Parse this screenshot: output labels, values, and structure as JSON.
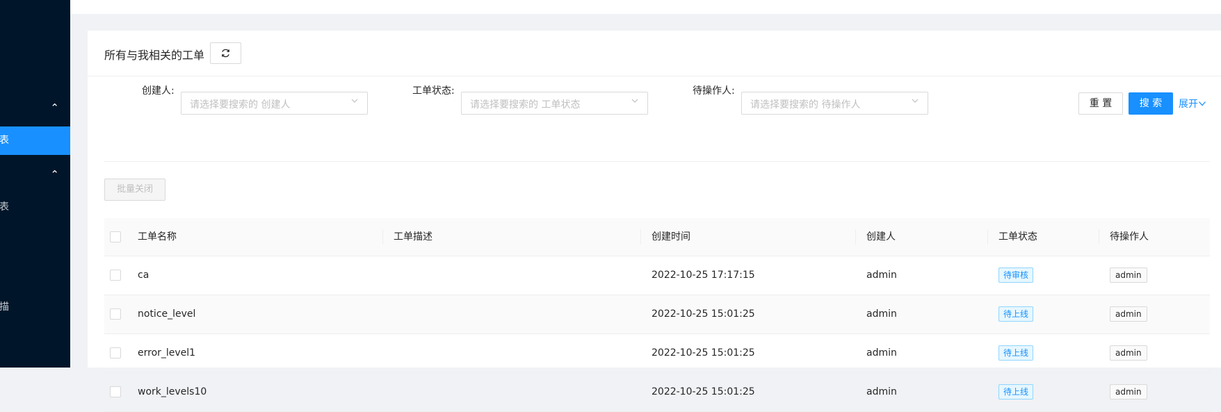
{
  "sidebar": {
    "groups": [
      {
        "chevron": "chevron-up-icon"
      },
      {
        "chevron": "chevron-up-icon"
      }
    ],
    "items": [
      {
        "label": "表",
        "active": true
      },
      {
        "label": "表",
        "active": false
      },
      {
        "label": "描",
        "active": false
      }
    ]
  },
  "card": {
    "title": "所有与我相关的工单",
    "refresh_icon": "refresh-icon"
  },
  "filters": {
    "creator": {
      "label": "创建人:",
      "placeholder": "请选择要搜索的 创建人"
    },
    "status": {
      "label": "工单状态:",
      "placeholder": "请选择要搜索的 工单状态"
    },
    "operator": {
      "label": "待操作人:",
      "placeholder": "请选择要搜索的 待操作人"
    },
    "reset_label": "重 置",
    "search_label": "搜 索",
    "expand_label": "展开"
  },
  "batch_close_label": "批量关闭",
  "table": {
    "columns": [
      "工单名称",
      "工单描述",
      "创建时间",
      "创建人",
      "工单状态",
      "待操作人"
    ],
    "rows": [
      {
        "name": "ca",
        "desc": "",
        "created": "2022-10-25 17:17:15",
        "creator": "admin",
        "status": "待审核",
        "operator": "admin"
      },
      {
        "name": "notice_level",
        "desc": "",
        "created": "2022-10-25 15:01:25",
        "creator": "admin",
        "status": "待上线",
        "operator": "admin"
      },
      {
        "name": "error_level1",
        "desc": "",
        "created": "2022-10-25 15:01:25",
        "creator": "admin",
        "status": "待上线",
        "operator": "admin"
      },
      {
        "name": "work_levels10",
        "desc": "",
        "created": "2022-10-25 15:01:25",
        "creator": "admin",
        "status": "待上线",
        "operator": "admin"
      }
    ]
  },
  "colors": {
    "sidebar_bg": "#001529",
    "accent": "#1890ff",
    "page_bg": "#f0f2f5"
  }
}
